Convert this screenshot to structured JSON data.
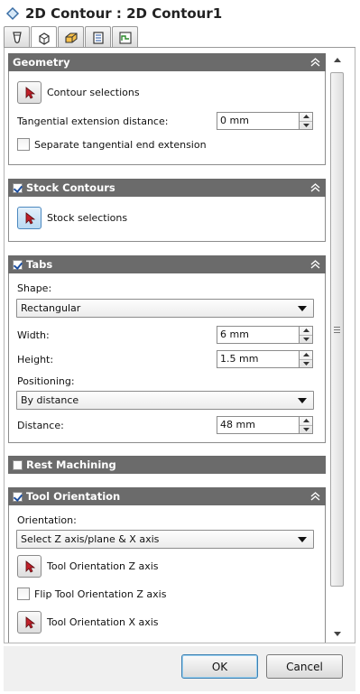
{
  "title": "2D Contour : 2D Contour1",
  "tabs": [
    {
      "icon": "tool-icon",
      "active": false
    },
    {
      "icon": "geometry-icon",
      "active": true
    },
    {
      "icon": "heights-icon",
      "active": false
    },
    {
      "icon": "passes-icon",
      "active": false
    },
    {
      "icon": "linking-icon",
      "active": false
    }
  ],
  "geometry": {
    "header": "Geometry",
    "contour_selections": "Contour selections",
    "tangential_label": "Tangential extension distance:",
    "tangential_value": "0 mm",
    "separate_label": "Separate tangential end extension",
    "separate_checked": false
  },
  "stock": {
    "header": "Stock Contours",
    "checked": true,
    "stock_selections": "Stock selections"
  },
  "tabs_group": {
    "header": "Tabs",
    "checked": true,
    "shape_label": "Shape:",
    "shape_value": "Rectangular",
    "width_label": "Width:",
    "width_value": "6 mm",
    "height_label": "Height:",
    "height_value": "1.5 mm",
    "positioning_label": "Positioning:",
    "positioning_value": "By distance",
    "distance_label": "Distance:",
    "distance_value": "48 mm"
  },
  "rest": {
    "header": "Rest Machining",
    "checked": false
  },
  "orientation": {
    "header": "Tool Orientation",
    "checked": true,
    "orientation_label": "Orientation:",
    "orientation_value": "Select Z axis/plane & X axis",
    "z_axis": "Tool Orientation Z axis",
    "flip_label": "Flip Tool Orientation Z axis",
    "flip_checked": false,
    "x_axis": "Tool Orientation X axis"
  },
  "buttons": {
    "ok": "OK",
    "cancel": "Cancel"
  },
  "colors": {
    "group_header": "#6b6b6b",
    "accent": "#1d4fa0",
    "arrow_red": "#c0202a"
  }
}
